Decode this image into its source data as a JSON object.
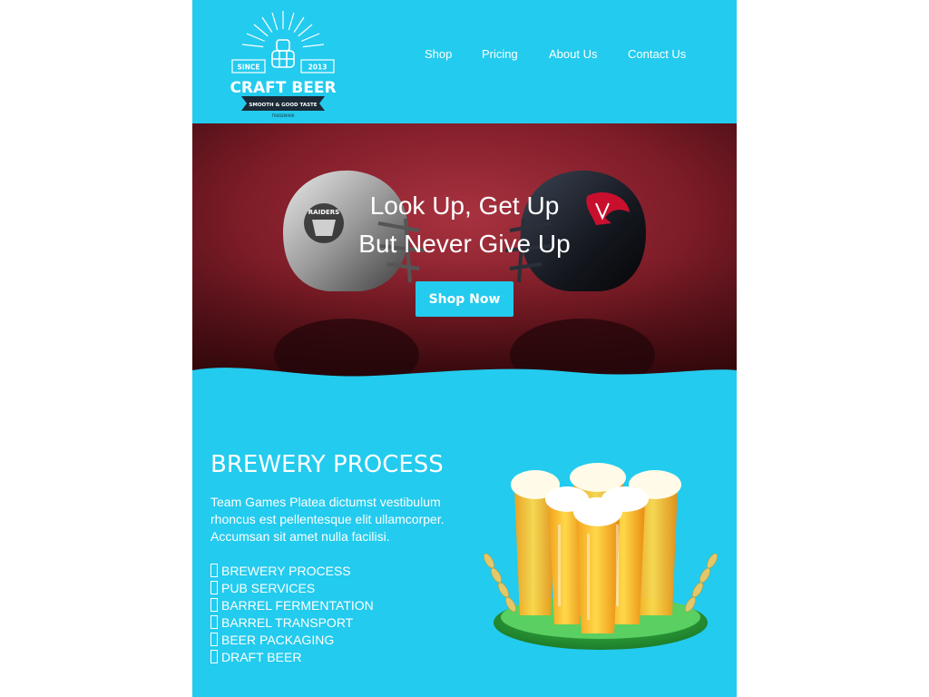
{
  "header": {
    "logo": {
      "since": "SINCE",
      "year": "2013",
      "brand": "CRAFT BEER",
      "tagline": "SMOOTH & GOOD TASTE",
      "trademark": "TRADEMARK"
    },
    "nav": [
      {
        "label": "Shop"
      },
      {
        "label": "Pricing"
      },
      {
        "label": "About Us"
      },
      {
        "label": "Contact Us"
      }
    ]
  },
  "hero": {
    "title_line1": "Look Up, Get Up",
    "title_line2": "But Never Give Up",
    "cta_label": "Shop Now",
    "helmet_left_text": "RAIDERS"
  },
  "content": {
    "title": "BREWERY PROCESS",
    "description": "Team Games Platea dictumst vestibulum rhoncus est pellentesque elit ullamcorper. Accumsan sit amet nulla facilisi.",
    "features": [
      "BREWERY PROCESS",
      "PUB SERVICES",
      "BARREL FERMENTATION",
      "BARREL TRANSPORT",
      "BEER PACKAGING",
      "DRAFT BEER"
    ]
  },
  "colors": {
    "brand": "#23cbee",
    "hero_bg": "#8a1f2b",
    "text": "#ffffff"
  }
}
